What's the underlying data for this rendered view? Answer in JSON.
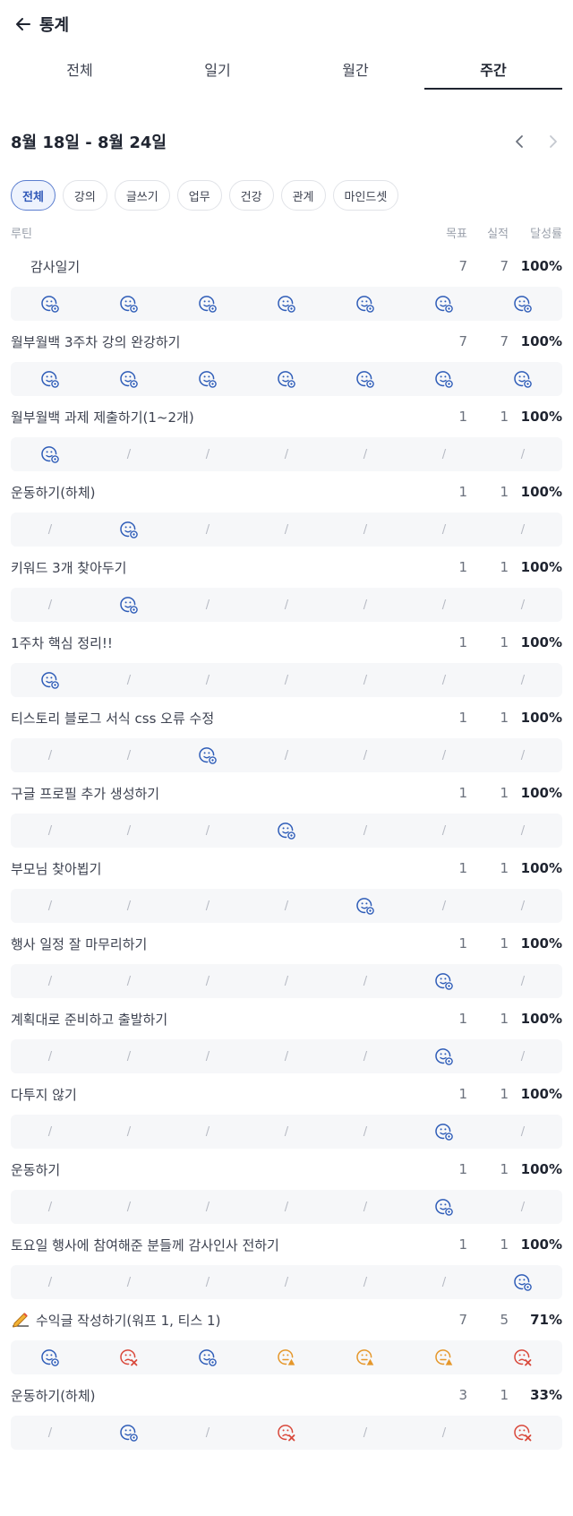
{
  "header": {
    "title": "통계"
  },
  "tabs": [
    {
      "label": "전체",
      "active": false
    },
    {
      "label": "일기",
      "active": false
    },
    {
      "label": "월간",
      "active": false
    },
    {
      "label": "주간",
      "active": true
    }
  ],
  "date_range": "8월 18일 - 8월 24일",
  "chips": [
    {
      "label": "전체",
      "active": true
    },
    {
      "label": "강의",
      "active": false
    },
    {
      "label": "글쓰기",
      "active": false
    },
    {
      "label": "업무",
      "active": false
    },
    {
      "label": "건강",
      "active": false
    },
    {
      "label": "관계",
      "active": false
    },
    {
      "label": "마인드셋",
      "active": false
    }
  ],
  "columns": {
    "routine": "루틴",
    "goal": "목표",
    "done": "실적",
    "rate": "달성률"
  },
  "colors": {
    "success": "#2f5db8",
    "warning": "#e5972b",
    "fail": "#d9483b",
    "accent": "#2f58b8"
  },
  "routines": [
    {
      "name": "감사일기",
      "indent": true,
      "goal": "7",
      "done": "7",
      "rate": "100%",
      "days": [
        "success",
        "success",
        "success",
        "success",
        "success",
        "success",
        "success"
      ]
    },
    {
      "name": "월부월백 3주차 강의 완강하기",
      "goal": "7",
      "done": "7",
      "rate": "100%",
      "days": [
        "success",
        "success",
        "success",
        "success",
        "success",
        "success",
        "success"
      ]
    },
    {
      "name": "월부월백 과제 제출하기(1~2개)",
      "goal": "1",
      "done": "1",
      "rate": "100%",
      "days": [
        "success",
        "none",
        "none",
        "none",
        "none",
        "none",
        "none"
      ]
    },
    {
      "name": "운동하기(하체)",
      "goal": "1",
      "done": "1",
      "rate": "100%",
      "days": [
        "none",
        "success",
        "none",
        "none",
        "none",
        "none",
        "none"
      ]
    },
    {
      "name": "키워드 3개 찾아두기",
      "goal": "1",
      "done": "1",
      "rate": "100%",
      "days": [
        "none",
        "success",
        "none",
        "none",
        "none",
        "none",
        "none"
      ]
    },
    {
      "name": "1주차 핵심 정리!!",
      "goal": "1",
      "done": "1",
      "rate": "100%",
      "days": [
        "success",
        "none",
        "none",
        "none",
        "none",
        "none",
        "none"
      ]
    },
    {
      "name": "티스토리 블로그 서식 css 오류 수정",
      "goal": "1",
      "done": "1",
      "rate": "100%",
      "days": [
        "none",
        "none",
        "success",
        "none",
        "none",
        "none",
        "none"
      ]
    },
    {
      "name": "구글 프로필 추가 생성하기",
      "goal": "1",
      "done": "1",
      "rate": "100%",
      "days": [
        "none",
        "none",
        "none",
        "success",
        "none",
        "none",
        "none"
      ]
    },
    {
      "name": "부모님 찾아뵙기",
      "goal": "1",
      "done": "1",
      "rate": "100%",
      "days": [
        "none",
        "none",
        "none",
        "none",
        "success",
        "none",
        "none"
      ]
    },
    {
      "name": "행사 일정 잘 마무리하기",
      "goal": "1",
      "done": "1",
      "rate": "100%",
      "days": [
        "none",
        "none",
        "none",
        "none",
        "none",
        "success",
        "none"
      ]
    },
    {
      "name": "계획대로 준비하고 출발하기",
      "goal": "1",
      "done": "1",
      "rate": "100%",
      "days": [
        "none",
        "none",
        "none",
        "none",
        "none",
        "success",
        "none"
      ]
    },
    {
      "name": "다투지 않기",
      "goal": "1",
      "done": "1",
      "rate": "100%",
      "days": [
        "none",
        "none",
        "none",
        "none",
        "none",
        "success",
        "none"
      ]
    },
    {
      "name": "운동하기",
      "goal": "1",
      "done": "1",
      "rate": "100%",
      "days": [
        "none",
        "none",
        "none",
        "none",
        "none",
        "success",
        "none"
      ]
    },
    {
      "name": "토요일 행사에 참여해준 분들께 감사인사 전하기",
      "goal": "1",
      "done": "1",
      "rate": "100%",
      "days": [
        "none",
        "none",
        "none",
        "none",
        "none",
        "none",
        "success"
      ]
    },
    {
      "name": "수익글 작성하기(워프 1, 티스 1)",
      "icon": "writing-hand-icon",
      "goal": "7",
      "done": "5",
      "rate": "71%",
      "days": [
        "success",
        "fail",
        "success",
        "warning",
        "warning",
        "warning",
        "fail"
      ]
    },
    {
      "name": "운동하기(하체)",
      "goal": "3",
      "done": "1",
      "rate": "33%",
      "days": [
        "none",
        "success",
        "none",
        "fail",
        "none",
        "none",
        "fail"
      ]
    }
  ]
}
